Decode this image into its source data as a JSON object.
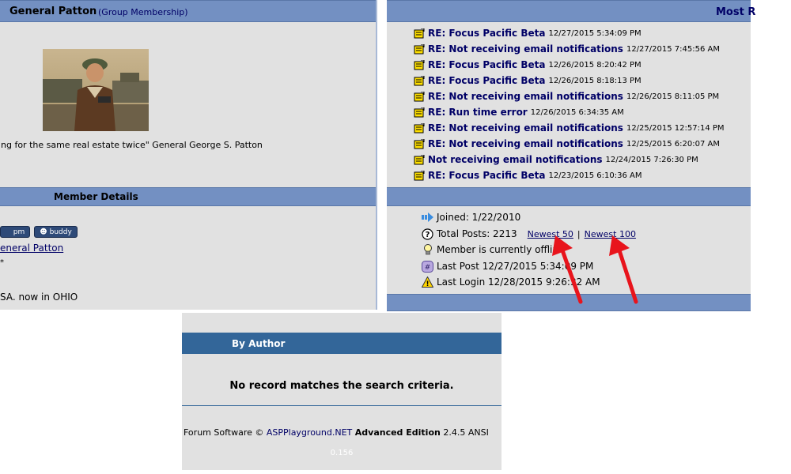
{
  "profile": {
    "name": "General Patton",
    "group_link": "(Group Membership)",
    "quote": "ng for the same real estate twice\" General George S. Patton",
    "member_details_title": "Member Details",
    "pm_label": "pm",
    "buddy_label": "buddy",
    "name_link": "eneral Patton",
    "asterisk": "*",
    "location": "SA. now in OHIO"
  },
  "recent": {
    "title": "Most R",
    "posts": [
      {
        "title": "RE: Focus Pacific Beta",
        "date": "12/27/2015 5:34:09 PM"
      },
      {
        "title": "RE: Not receiving email notifications",
        "date": "12/27/2015 7:45:56 AM"
      },
      {
        "title": "RE: Focus Pacific Beta",
        "date": "12/26/2015 8:20:42 PM"
      },
      {
        "title": "RE: Focus Pacific Beta",
        "date": "12/26/2015 8:18:13 PM"
      },
      {
        "title": "RE: Not receiving email notifications",
        "date": "12/26/2015 8:11:05 PM"
      },
      {
        "title": "RE: Run time error",
        "date": "12/26/2015 6:34:35 AM"
      },
      {
        "title": "RE: Not receiving email notifications",
        "date": "12/25/2015 12:57:14 PM"
      },
      {
        "title": "RE: Not receiving email notifications",
        "date": "12/25/2015 6:20:07 AM"
      },
      {
        "title": "Not receiving email notifications",
        "date": "12/24/2015 7:26:30 PM"
      },
      {
        "title": "RE: Focus Pacific Beta",
        "date": "12/23/2015 6:10:36 AM"
      }
    ]
  },
  "stats": {
    "joined": "Joined: 1/22/2010",
    "total_posts": "Total Posts: 2213",
    "newest50": "Newest 50",
    "separator": "|",
    "newest100": "Newest 100",
    "online_status": "Member is currently offlin",
    "last_post": "Last Post 12/27/2015 5:34:09 PM",
    "last_login": "Last Login 12/28/2015 9:26:32 AM"
  },
  "search": {
    "header": "By Author",
    "message": "No record matches the search criteria.",
    "footer_prefix": "Forum Software © ",
    "footer_link": "ASPPlayground.NET",
    "footer_edition": "Advanced Edition",
    "footer_version": "2.4.5 ANSI",
    "timing": "0.156"
  },
  "colors": {
    "header_blue": "#7390c2",
    "panel_gray": "#e1e1e1",
    "dark_header": "#336699",
    "link_navy": "#000066",
    "arrow_red": "#e8141c"
  },
  "icons": [
    "topic-icon",
    "arrow-right-icon",
    "question-icon",
    "lightbulb-icon",
    "hash-icon",
    "warning-icon",
    "red-arrow-annotation"
  ]
}
